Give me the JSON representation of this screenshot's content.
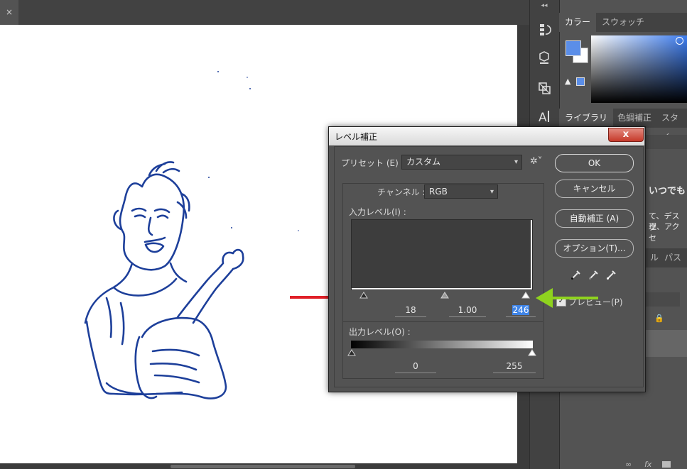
{
  "document": {
    "tab_close": "×"
  },
  "tools": {
    "collapse": "◂◂",
    "items": [
      "history-icon",
      "3d-icon",
      "transform-icon",
      "character-icon"
    ]
  },
  "panels": {
    "color_tabs": [
      "カラー",
      "スウォッチ"
    ],
    "library_tabs": [
      "ライブラリ",
      "色調補正",
      "スタイ"
    ],
    "library_heading": "いつでも",
    "library_text_1": "て、デスク",
    "library_text_2": "理、アクセ",
    "layers_tabs": [
      "ル",
      "パス"
    ],
    "colors": {
      "foreground": "#5b8ee8",
      "background": "#ffffff"
    }
  },
  "dialog": {
    "title": "レベル補正",
    "close_glyph": "x",
    "preset_label": "プリセット (E) :",
    "preset_value": "カスタム",
    "gear_glyph": "✲˅",
    "channel_label": "チャンネル :",
    "channel_value": "RGB",
    "input_label": "入力レベル(I) :",
    "input_shadow": "18",
    "input_gamma": "1.00",
    "input_highlight": "246",
    "output_label": "出力レベル(O) :",
    "output_shadow": "0",
    "output_highlight": "255",
    "buttons": {
      "ok": "OK",
      "cancel": "キャンセル",
      "auto": "自動補正 (A)",
      "options": "オプション(T)..."
    },
    "preview_label": "プレビュー(P)",
    "preview_checked": true
  },
  "sliders": {
    "input_shadow_level": 18,
    "input_gamma_position": 0.5,
    "input_highlight_level": 246,
    "output_shadow_level": 0,
    "output_highlight_level": 255
  }
}
